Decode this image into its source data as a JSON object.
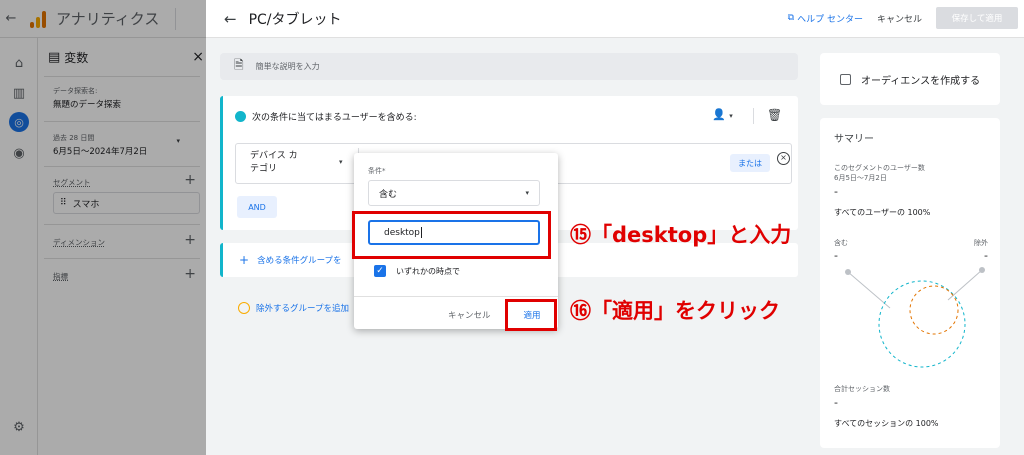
{
  "app": {
    "title": "アナリティクス"
  },
  "variables": {
    "header": "変数",
    "exploration_name_label": "データ探索名:",
    "exploration_name": "無題のデータ探索",
    "date_label": "過去 28 日間",
    "date_range": "6月5日～2024年7月2日",
    "segment_label": "セグメント",
    "segment_item": "スマホ",
    "dimension_label": "ディメンション",
    "metric_label": "指標"
  },
  "editor": {
    "title": "PC/タブレット",
    "help": "ヘルプ センター",
    "cancel": "キャンセル",
    "save": "保存して適用",
    "description_placeholder": "簡単な説明を入力",
    "condition_header": "次の条件に当てはまるユーザーを含める:",
    "dimension": "デバイス カ テゴリ",
    "dimension_line1": "デバイス カ",
    "dimension_line2": "テゴリ",
    "or_label": "または",
    "and_label": "AND",
    "add_group": "含める条件グループを",
    "exclude_group": "除外するグループを追加"
  },
  "popup": {
    "condition_label": "条件*",
    "condition_value": "含む",
    "input_value": "desktop",
    "checkbox_label": "いずれかの時点で",
    "cancel": "キャンセル",
    "apply": "適用"
  },
  "audience": {
    "label": "オーディエンスを作成する"
  },
  "summary": {
    "title": "サマリー",
    "users_label": "このセグメントのユーザー数",
    "date": "6月5日～7月2日",
    "dash": "-",
    "users_pct": "すべてのユーザーの 100%",
    "include": "含む",
    "exclude": "除外",
    "sessions_label": "合計セッション数",
    "sessions_pct": "すべてのセッションの 100%"
  },
  "annotations": {
    "step15": "⑮「desktop」と入力",
    "step16": "⑯「適用」をクリック"
  },
  "colors": {
    "accent": "#1a73e8",
    "teal": "#12b5cb",
    "highlight": "#e00000",
    "orange": "#e37400"
  }
}
